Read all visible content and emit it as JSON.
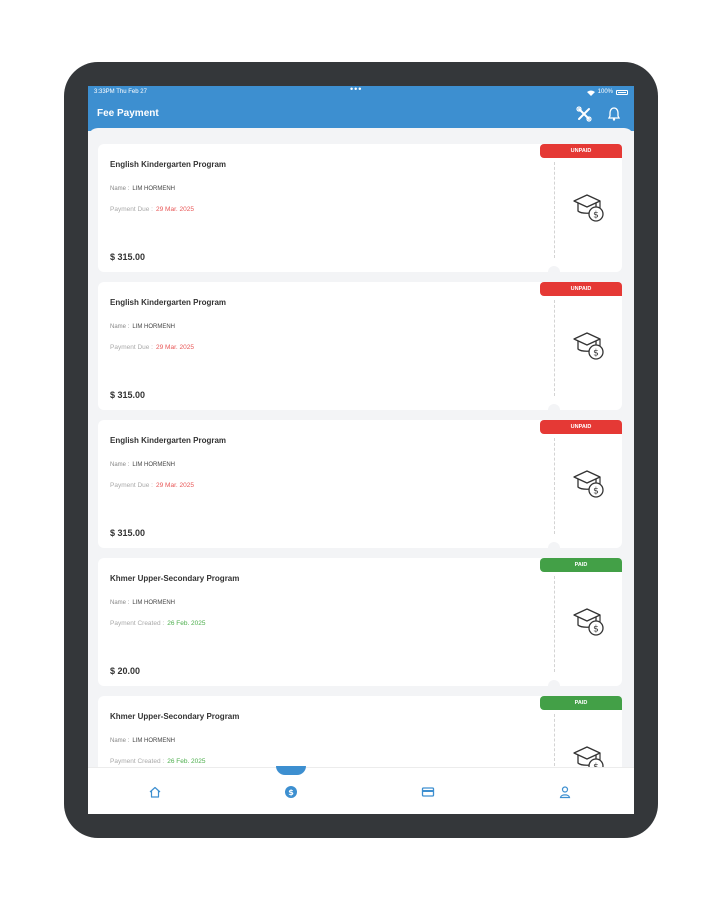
{
  "status_bar": {
    "time": "3:33PM  Thu Feb 27",
    "dots": "•••",
    "battery": "100%"
  },
  "app_bar": {
    "title": "Fee Payment",
    "icons": [
      "tools-icon",
      "bell-icon"
    ]
  },
  "cards": [
    {
      "program": "English Kindergarten Program",
      "name_label": "Name :",
      "name": "LIM HORMENH",
      "date_label": "Payment Due :",
      "date": "29 Mar. 2025",
      "amount": "$ 315.00",
      "status": "UNPAID"
    },
    {
      "program": "English Kindergarten Program",
      "name_label": "Name :",
      "name": "LIM HORMENH",
      "date_label": "Payment Due :",
      "date": "29 Mar. 2025",
      "amount": "$ 315.00",
      "status": "UNPAID"
    },
    {
      "program": "English Kindergarten Program",
      "name_label": "Name :",
      "name": "LIM HORMENH",
      "date_label": "Payment Due :",
      "date": "29 Mar. 2025",
      "amount": "$ 315.00",
      "status": "UNPAID"
    },
    {
      "program": "Khmer Upper-Secondary Program",
      "name_label": "Name :",
      "name": "LIM HORMENH",
      "date_label": "Payment Created :",
      "date": "26 Feb. 2025",
      "amount": "$ 20.00",
      "status": "PAID"
    },
    {
      "program": "Khmer Upper-Secondary Program",
      "name_label": "Name :",
      "name": "LIM HORMENH",
      "date_label": "Payment Created :",
      "date": "26 Feb. 2025",
      "amount": "",
      "status": "PAID"
    }
  ],
  "bottom_nav": {
    "items": [
      "home-icon",
      "payment-icon",
      "card-icon",
      "profile-icon"
    ],
    "active": "payment-icon"
  },
  "colors": {
    "primary": "#3d8fd0",
    "unpaid": "#e53935",
    "paid": "#43a047"
  }
}
